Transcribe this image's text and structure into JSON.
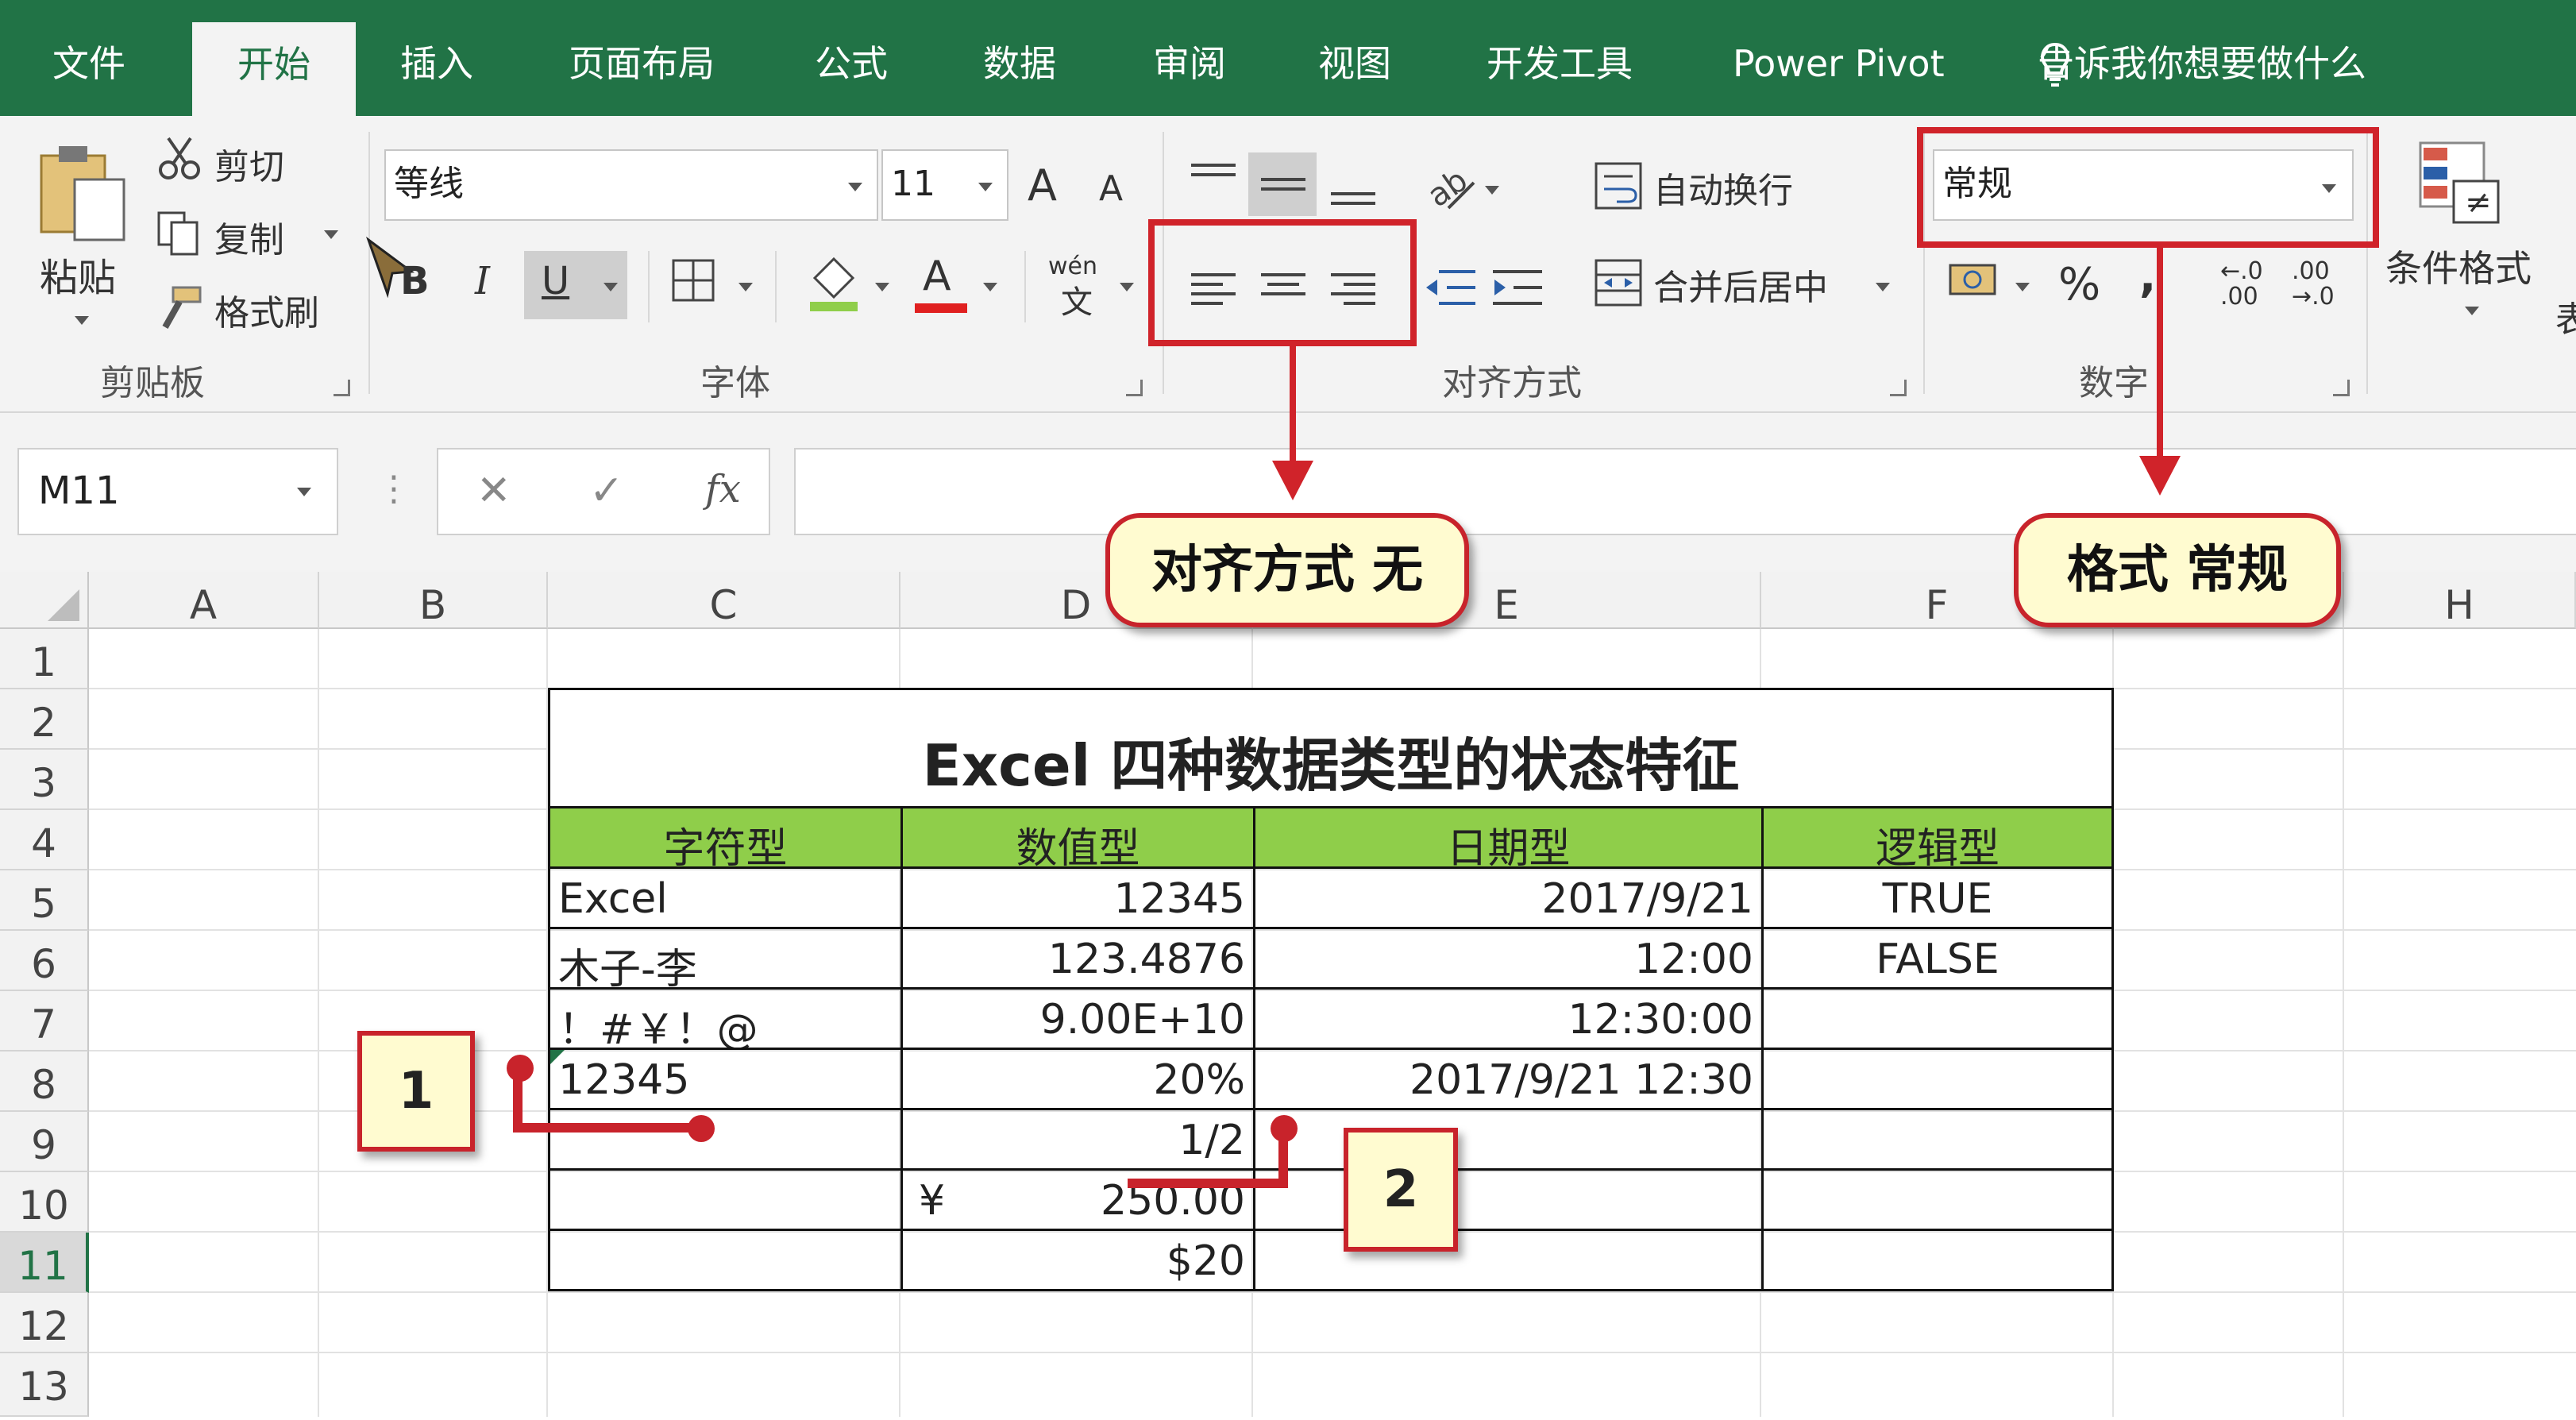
{
  "menu": {
    "file": "文件",
    "home": "开始",
    "insert": "插入",
    "page_layout": "页面布局",
    "formulas": "公式",
    "data": "数据",
    "review": "审阅",
    "view": "视图",
    "developer": "开发工具",
    "power_pivot": "Power Pivot",
    "tell_me": "告诉我你想要做什么"
  },
  "clipboard": {
    "paste": "粘贴",
    "cut": "剪切",
    "copy": "复制",
    "format_painter": "格式刷",
    "label": "剪贴板"
  },
  "font": {
    "name": "等线",
    "size": "11",
    "grow": "A",
    "shrink": "A",
    "bold": "B",
    "italic": "I",
    "underline": "U",
    "color_letter": "A",
    "phonetic_top": "wén",
    "phonetic_bottom": "文",
    "label": "字体"
  },
  "alignment": {
    "wrap_text": "自动换行",
    "merge_center": "合并后居中",
    "label": "对齐方式"
  },
  "number": {
    "format": "常规",
    "percent": "%",
    "comma": ",",
    "increase_decimal": "←.0 .00",
    "decrease_decimal": ".00 →.0",
    "label": "数字"
  },
  "styles": {
    "conditional_format": "条件格式",
    "cut_text": "表"
  },
  "formula_bar": {
    "name_box": "M11",
    "fx": "fx",
    "cancel": "✕",
    "enter": "✓",
    "dots": "⋮"
  },
  "columns": [
    "A",
    "B",
    "C",
    "D",
    "E",
    "F",
    "H"
  ],
  "rows": [
    "1",
    "2",
    "3",
    "4",
    "5",
    "6",
    "7",
    "8",
    "9",
    "10",
    "11",
    "12",
    "13"
  ],
  "table": {
    "title": "Excel 四种数据类型的状态特征",
    "headers": [
      "字符型",
      "数值型",
      "日期型",
      "逻辑型"
    ],
    "text_col": [
      "Excel",
      "木子-李",
      "！#￥！@",
      "12345",
      "",
      "",
      ""
    ],
    "number_col": [
      "12345",
      "123.4876",
      "9.00E+10",
      "20%",
      "1/2",
      "250.00",
      "$20"
    ],
    "currency_symbol": "¥",
    "date_col": [
      "2017/9/21",
      "12:00",
      "12:30:00",
      "2017/9/21 12:30",
      "",
      "",
      ""
    ],
    "logic_col": [
      "TRUE",
      "FALSE",
      "",
      "",
      "",
      "",
      ""
    ]
  },
  "callouts": {
    "alignment_note": "对齐方式 无",
    "format_note": "格式 常规",
    "marker_1": "1",
    "marker_2": "2"
  },
  "colors": {
    "ribbon_green": "#217346",
    "header_green": "#8fce4a",
    "callout_red": "#d0232a",
    "callout_fill": "#fffbd0"
  }
}
